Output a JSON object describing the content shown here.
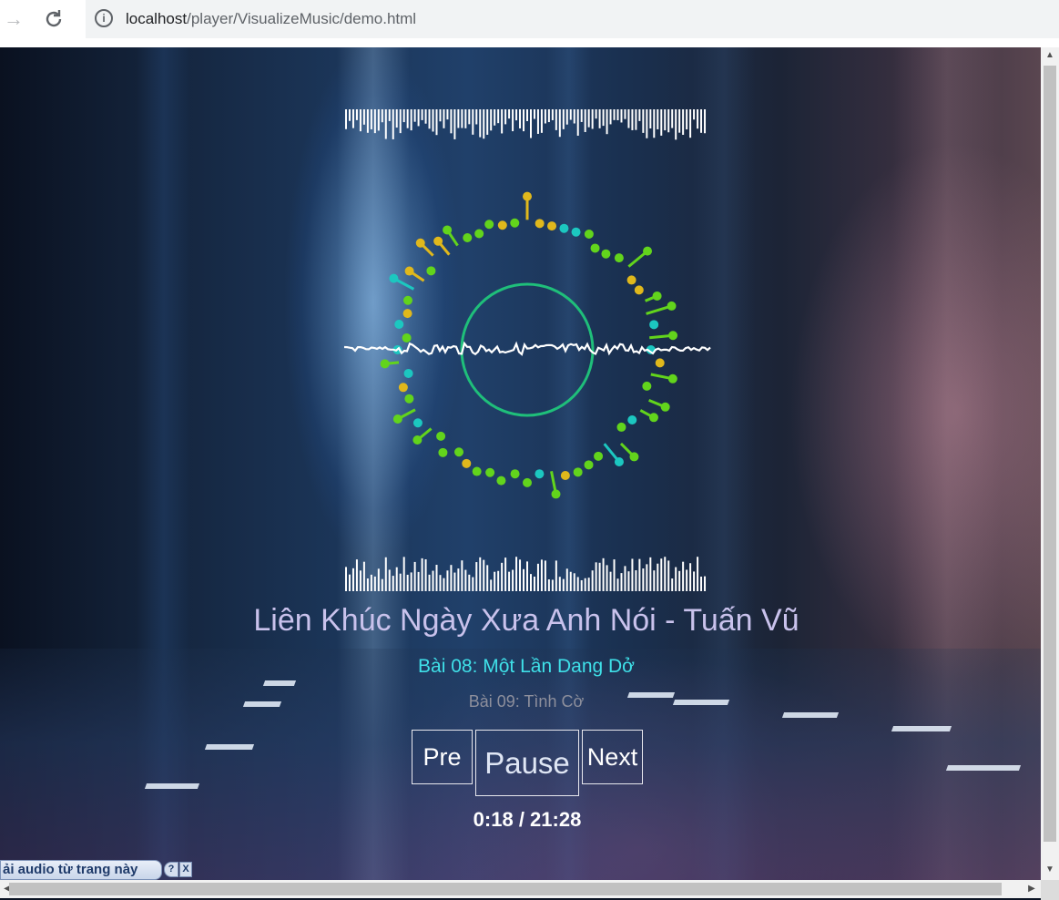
{
  "browser": {
    "url_host": "localhost",
    "url_path": "/player/VisualizeMusic/demo.html"
  },
  "player": {
    "title": "Liên Khúc Ngày Xưa Anh Nói - Tuấn Vũ",
    "current_track": "Bài 08: Một Lần Dang Dở",
    "next_track": "Bài 09: Tình Cờ",
    "buttons": {
      "prev": "Pre",
      "pause": "Pause",
      "next": "Next"
    },
    "time": "0:18 / 21:28",
    "colors": {
      "title": "#c9c2ec",
      "current_track": "#3fe0e8",
      "ring": "#1fbf7a",
      "dot_primary": "#62d41c",
      "dot_accent": "#e0b81c",
      "dot_cyan": "#1cc7c0"
    }
  },
  "download_bar": {
    "label": "ải audio từ trang này",
    "help": "?",
    "close": "X"
  }
}
